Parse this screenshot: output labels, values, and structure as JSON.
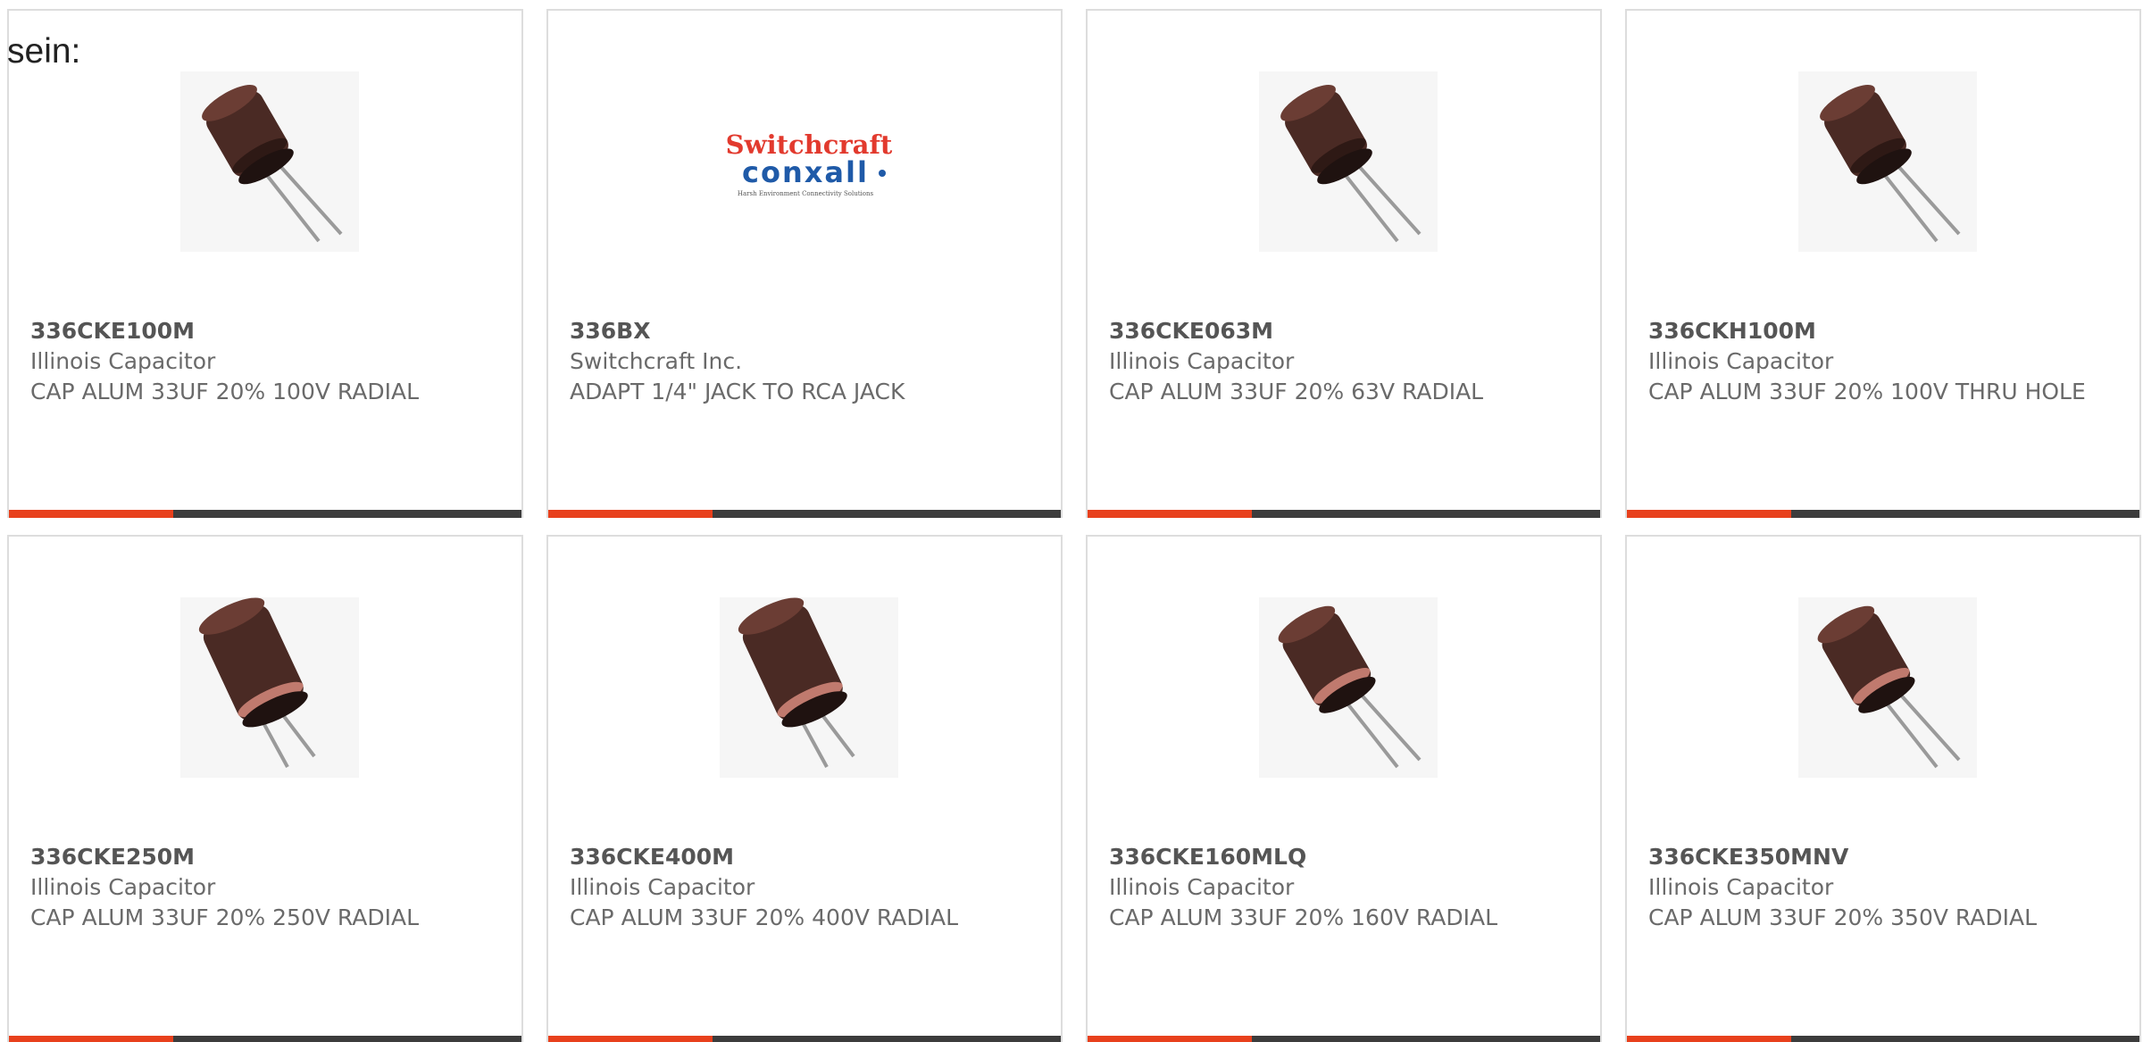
{
  "leading_text": "sein:",
  "colors": {
    "accent": "#e8401c",
    "bar": "#3c3c3c",
    "border": "#dddddd",
    "text": "#6a6a6a"
  },
  "products": [
    {
      "part_number": "336CKE100M",
      "manufacturer": "Illinois Capacitor",
      "description": "CAP ALUM 33UF 20% 100V RADIAL",
      "image": "capacitor-photo"
    },
    {
      "part_number": "336BX",
      "manufacturer": "Switchcraft Inc.",
      "description": "ADAPT 1/4\" JACK TO RCA JACK",
      "image": "switchcraft-conxall-logo",
      "logo_line1": "Switchcraft",
      "logo_line2": "conxall",
      "logo_tagline": "Harsh Environment Connectivity Solutions"
    },
    {
      "part_number": "336CKE063M",
      "manufacturer": "Illinois Capacitor",
      "description": "CAP ALUM 33UF 20% 63V RADIAL",
      "image": "capacitor-photo"
    },
    {
      "part_number": "336CKH100M",
      "manufacturer": "Illinois Capacitor",
      "description": "CAP ALUM 33UF 20% 100V THRU HOLE",
      "image": "capacitor-photo"
    },
    {
      "part_number": "336CKE250M",
      "manufacturer": "Illinois Capacitor",
      "description": "CAP ALUM 33UF 20% 250V RADIAL",
      "image": "capacitor-photo"
    },
    {
      "part_number": "336CKE400M",
      "manufacturer": "Illinois Capacitor",
      "description": "CAP ALUM 33UF 20% 400V RADIAL",
      "image": "capacitor-photo"
    },
    {
      "part_number": "336CKE160MLQ",
      "manufacturer": "Illinois Capacitor",
      "description": "CAP ALUM 33UF 20% 160V RADIAL",
      "image": "capacitor-photo"
    },
    {
      "part_number": "336CKE350MNV",
      "manufacturer": "Illinois Capacitor",
      "description": "CAP ALUM 33UF 20% 350V RADIAL",
      "image": "capacitor-photo"
    }
  ]
}
